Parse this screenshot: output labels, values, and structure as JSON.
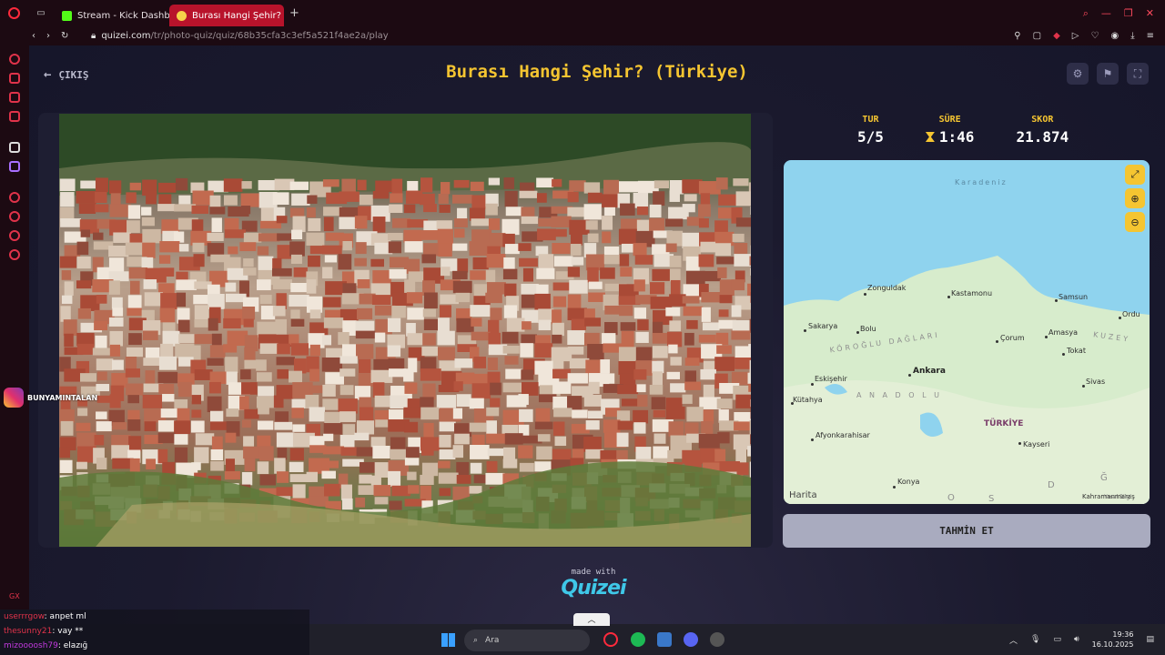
{
  "browser": {
    "tabs": [
      {
        "label": "Stream - Kick Dashboard",
        "active": false
      },
      {
        "label": "Burası Hangi Şehir? (Türk",
        "active": true
      }
    ],
    "new_tab": "+",
    "url_host": "quizei.com",
    "url_path": "/tr/photo-quiz/quiz/68b35cfa3c3ef5a521f4ae2a/play"
  },
  "header": {
    "exit_label": "ÇIKIŞ",
    "title": "Burası Hangi Şehir? (Türkiye)",
    "tools": [
      "gear-icon",
      "flag-icon",
      "fullscreen-icon"
    ]
  },
  "stats": {
    "round_label": "TUR",
    "round_value": "5/5",
    "time_label": "SÜRE",
    "time_value": "1:46",
    "score_label": "SKOR",
    "score_value": "21.874"
  },
  "map": {
    "sea": "Karadeniz",
    "cities": {
      "zonguldak": "Zonguldak",
      "kastamonu": "Kastamonu",
      "samsun": "Samsun",
      "ordu": "Ordu",
      "sakarya": "Sakarya",
      "bolu": "Bolu",
      "amasya": "Amasya",
      "corum": "Çorum",
      "tokat": "Tokat",
      "eskisehir": "Eskişehir",
      "ankara": "Ankara",
      "sivas": "Sivas",
      "kutahya": "Kütahya",
      "afyon": "Afyonkarahisar",
      "kayseri": "Kayseri",
      "konya": "Konya",
      "kahramanmaras": "Kahramanmaraş"
    },
    "regions": {
      "koroglu": "KÖROĞLU DAĞLARI",
      "kuzey": "KUZEY",
      "anadolu": "A N A D O L U",
      "d": "D",
      "o": "O",
      "g": "Ğ",
      "s": "S"
    },
    "country": "TÜRKİYE",
    "credit": "Harita",
    "legal": "Yasal Bilgi",
    "buttons": [
      "expand-icon",
      "zoom-in-icon",
      "zoom-out-icon"
    ]
  },
  "guess_button": "TAHMİN ET",
  "footer": {
    "made_with": "made with",
    "logo": "Quizei"
  },
  "overlay": {
    "instagram_handle": "BUNYAMINTALAN",
    "gx": "GX"
  },
  "chat": [
    {
      "user": "userrrgow",
      "message": ": anpet ml"
    },
    {
      "user": "thesunny21",
      "message": ": vay **"
    },
    {
      "user": "mizoooosh79",
      "message": ": elazığ"
    }
  ],
  "taskbar": {
    "search_placeholder": "Ara",
    "time": "19:36",
    "date": "16.10.2025"
  },
  "colors": {
    "accent": "#f5c531",
    "page_bg": "#1b1a2e",
    "browser_accent": "#b8132b"
  }
}
